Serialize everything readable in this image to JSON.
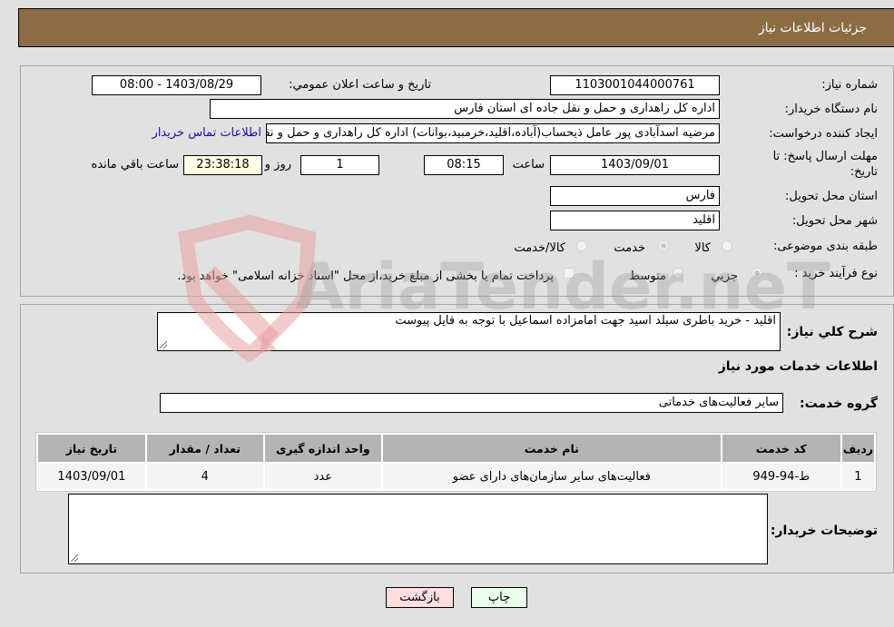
{
  "header": {
    "title": "جزئیات اطلاعات نیاز"
  },
  "form": {
    "need_number": {
      "label": "شماره نیاز:",
      "value": "1103001044000761"
    },
    "announce_datetime": {
      "label": "تاریخ و ساعت اعلان عمومي:",
      "value": "1403/08/29 - 08:00"
    },
    "buyer_org": {
      "label": "نام دستگاه خریدار:",
      "value": "اداره کل راهداری و حمل و نقل جاده ای استان فارس"
    },
    "requester": {
      "label": "ایجاد کننده درخواست:",
      "value": "مرضیه اسدآبادی پور عامل ذیحساب(آباده،اقلید،خرمبید،بوانات) اداره کل راهداری و حمل و نقل جاده ای استان فارس",
      "contact_link": "اطلاعات تماس خریدار"
    },
    "deadline": {
      "label_line1": "مهلت ارسال پاسخ: تا",
      "label_line2": "تاریخ:",
      "date": "1403/09/01",
      "time_label": "ساعت",
      "time": "08:15",
      "days": "1",
      "days_label": "روز و",
      "remaining": "23:38:18",
      "remaining_label": "ساعت باقي مانده"
    },
    "province": {
      "label": "استان محل تحویل:",
      "value": "فارس"
    },
    "city": {
      "label": "شهر محل تحویل:",
      "value": "اقلید"
    },
    "category": {
      "label": "طبقه بندی موضوعی:",
      "options": [
        "کالا",
        "خدمت",
        "کالا/خدمت"
      ],
      "selected": "خدمت"
    },
    "purchase_type": {
      "label": "نوع فرآیند خرید :",
      "options": [
        "جزيي",
        "متوسط"
      ],
      "selected": "جزيي",
      "treasury_note": "پرداخت تمام یا بخشی از مبلغ خرید،از محل \"اسناد خزانه اسلامی\" خواهد بود."
    }
  },
  "description": {
    "label": "شرح کلي نیاز:",
    "value": "اقلید - خرید باطری سیلد اسید جهت امامزاده اسماعیل با توجه به فایل پیوست"
  },
  "services_section": {
    "title": "اطلاعات خدمات مورد نیاز"
  },
  "service_group": {
    "label": "گروه خدمت:",
    "value": "سایر فعالیت‌های خدماتی"
  },
  "services_table": {
    "columns": [
      "ردیف",
      "کد خدمت",
      "نام خدمت",
      "واحد اندازه گیری",
      "تعداد / مقدار",
      "تاریخ نیاز"
    ],
    "rows": [
      [
        "1",
        "ط-94-949",
        "فعالیت‌های سایر سازمان‌های دارای عضو",
        "عدد",
        "4",
        "1403/09/01"
      ]
    ]
  },
  "buyer_notes": {
    "label": "توضیحات خریدار:",
    "value": ""
  },
  "buttons": {
    "print": "چاپ",
    "back": "بازگشت"
  },
  "watermark": {
    "text": "AriaTender.neT"
  }
}
